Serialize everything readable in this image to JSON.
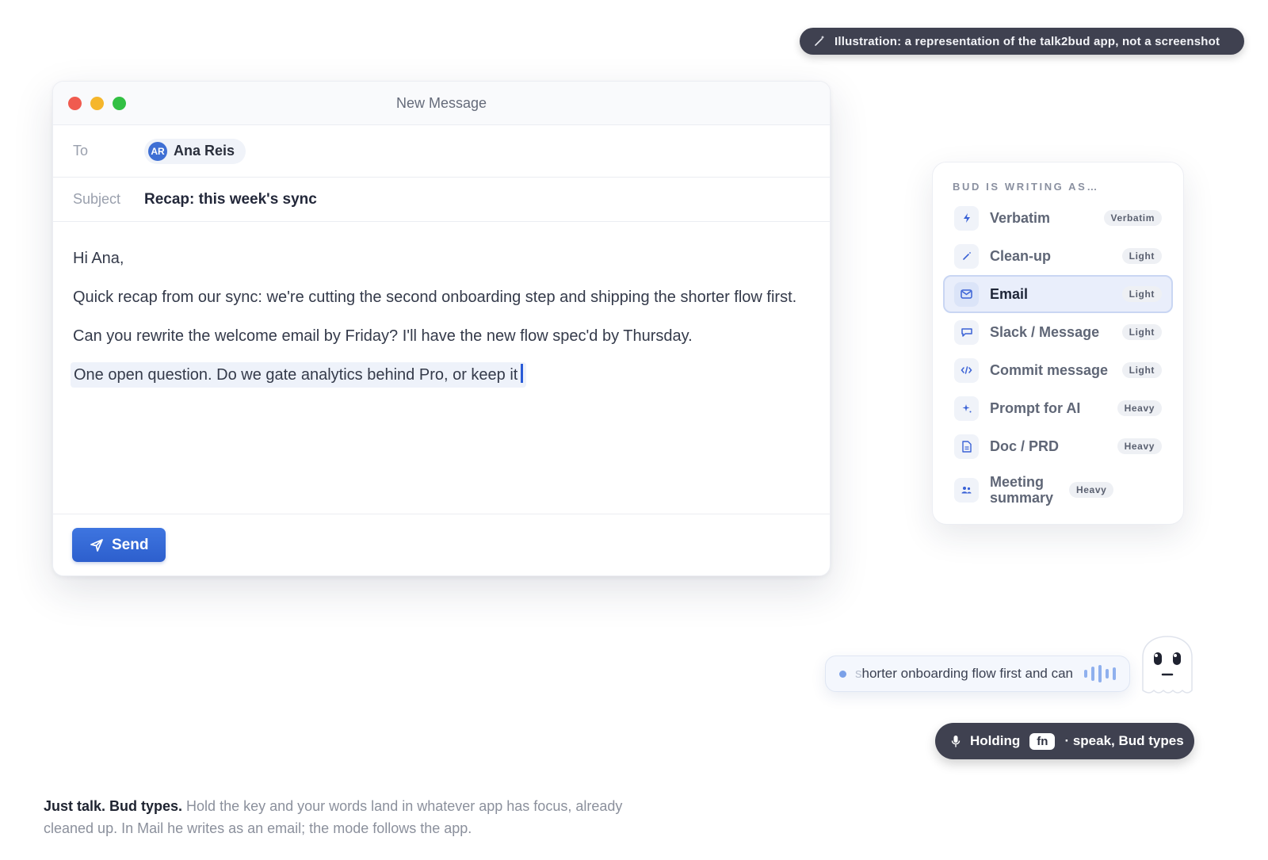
{
  "illustration_pill": {
    "icon": "wand-icon",
    "text": "Illustration: a representation of the talk2bud app, not a screenshot"
  },
  "mail": {
    "window_title": "New Message",
    "to_label": "To",
    "recipient": {
      "initials": "AR",
      "name": "Ana Reis"
    },
    "subject_label": "Subject",
    "subject_value": "Recap: this week's sync",
    "body": {
      "greeting": "Hi Ana,",
      "paragraph1": "Quick recap from our sync: we're cutting the second onboarding step and shipping the shorter flow first.",
      "paragraph2": "Can you rewrite the welcome email by Friday? I'll have the new flow spec'd by Thursday.",
      "typing_line": "One open question. Do we gate analytics behind Pro, or keep it"
    },
    "send_label": "Send",
    "colors": {
      "send": "#2d5fcd",
      "close": "#f05b4f",
      "minimize": "#f5b62b",
      "zoom": "#32c043"
    }
  },
  "mode_panel": {
    "heading": "BUD IS WRITING AS…",
    "items": [
      {
        "label": "Verbatim",
        "badge": "Verbatim",
        "icon": "bolt-icon",
        "active": false
      },
      {
        "label": "Clean-up",
        "badge": "Light",
        "icon": "wand-icon",
        "active": false
      },
      {
        "label": "Email",
        "badge": "Light",
        "icon": "envelope-icon",
        "active": true
      },
      {
        "label": "Slack / Message",
        "badge": "Light",
        "icon": "chat-icon",
        "active": false
      },
      {
        "label": "Commit message",
        "badge": "Light",
        "icon": "code-icon",
        "active": false
      },
      {
        "label": "Prompt for AI",
        "badge": "Heavy",
        "icon": "sparkle-icon",
        "active": false
      },
      {
        "label": "Doc / PRD",
        "badge": "Heavy",
        "icon": "document-icon",
        "active": false
      },
      {
        "label": "Meeting summary",
        "badge": "Heavy",
        "icon": "people-icon",
        "active": false
      }
    ]
  },
  "voice": {
    "faded_text": "s",
    "text": "horter onboarding flow first and can",
    "waveform_icon": "waveform-icon"
  },
  "holding_pill": {
    "icon": "microphone-icon",
    "prefix": "Holding",
    "key": "fn",
    "suffix": "· speak, Bud types"
  },
  "caption": {
    "bold": "Just talk. Bud types.",
    "text": " Hold the key and your words land in whatever app has focus, already cleaned up. In Mail he writes as an email; the mode follows the app."
  }
}
